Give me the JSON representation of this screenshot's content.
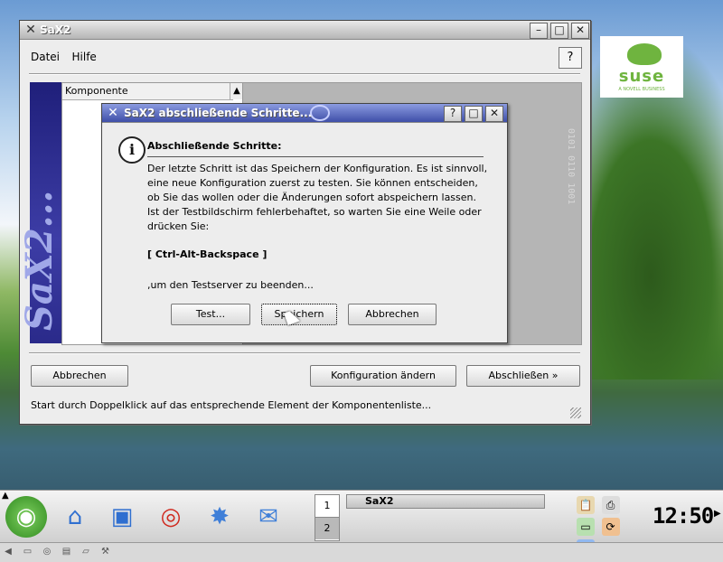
{
  "main_window": {
    "title": "SaX2",
    "menu": [
      "Datei",
      "Hilfe"
    ],
    "tree_header": "Komponente",
    "sidebar_text": "SaX2...",
    "buttons": {
      "cancel": "Abbrechen",
      "change_config": "Konfiguration ändern",
      "finish": "Abschließen »"
    },
    "status_text": "Start durch Doppelklick auf das entsprechende Element der Komponentenliste..."
  },
  "dialog": {
    "title": "SaX2 abschließende Schritte...",
    "heading": "Abschließende Schritte:",
    "body": "Der letzte Schritt ist das Speichern der Konfiguration. Es ist sinnvoll, eine neue Konfiguration zuerst zu testen. Sie können entscheiden, ob Sie das wollen oder die Änderungen sofort abspeichern lassen. Ist der Testbildschirm fehlerbehaftet, so warten Sie eine Weile oder drücken Sie:",
    "keys": "[ Ctrl-Alt-Backspace ]",
    "end_text": ",um den Testserver zu beenden...",
    "buttons": {
      "test": "Test...",
      "save": "Speichern",
      "cancel": "Abbrechen"
    }
  },
  "panel": {
    "pager": [
      "1",
      "2"
    ],
    "task": "SaX2",
    "clock": "12:50"
  },
  "suse_logo": {
    "word": "suse",
    "subtitle": "A NOVELL BUSINESS"
  },
  "colors": {
    "dialog_titlebar": "#3f4fa8",
    "sidebar": "#2a2a8a",
    "suse_green": "#6fb43f"
  }
}
